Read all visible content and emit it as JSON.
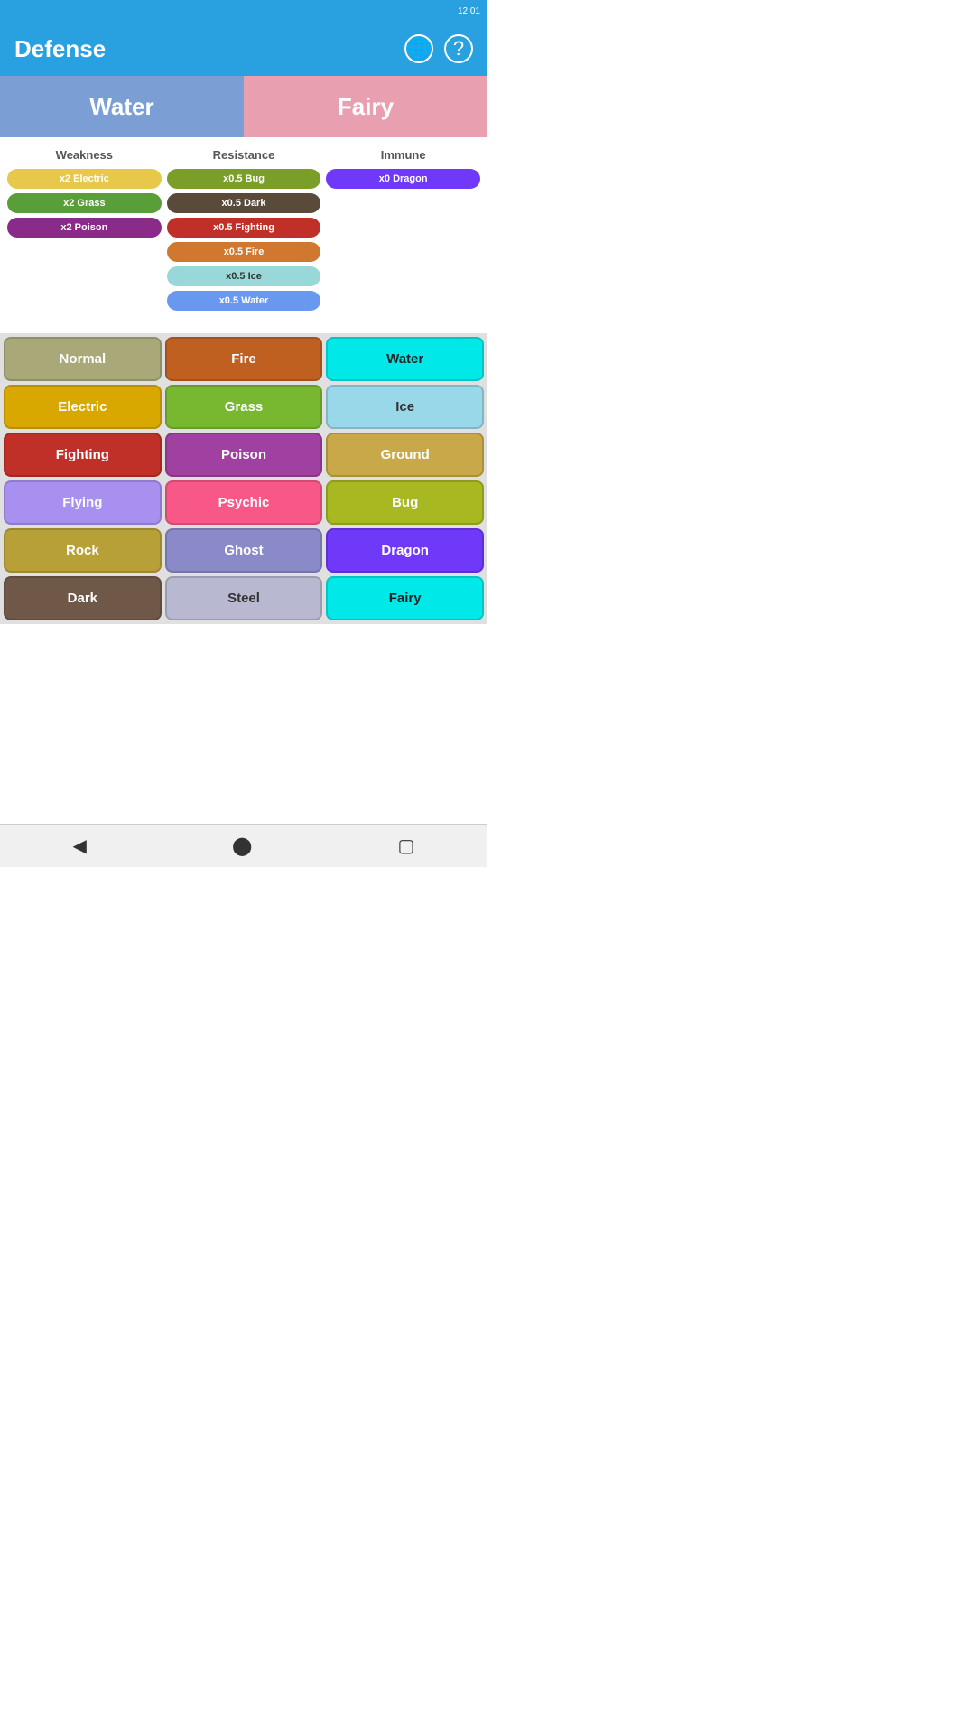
{
  "app": {
    "title": "Defense",
    "time": "12:01"
  },
  "header": {
    "title": "Defense",
    "globe_icon": "🌐",
    "help_icon": "?"
  },
  "type_selector": {
    "left": "Water",
    "right": "Fairy"
  },
  "defense": {
    "weakness_header": "Weakness",
    "resistance_header": "Resistance",
    "immune_header": "Immune",
    "weaknesses": [
      "x2 Electric",
      "x2 Grass",
      "x2 Poison"
    ],
    "resistances": [
      "x0.5 Bug",
      "x0.5 Dark",
      "x0.5 Fighting",
      "x0.5 Fire",
      "x0.5 Ice",
      "x0.5 Water"
    ],
    "immunities": [
      "x0 Dragon"
    ]
  },
  "type_grid": [
    {
      "label": "Normal",
      "style": "tg-normal"
    },
    {
      "label": "Fire",
      "style": "tg-fire"
    },
    {
      "label": "Water",
      "style": "tg-water"
    },
    {
      "label": "Electric",
      "style": "tg-electric"
    },
    {
      "label": "Grass",
      "style": "tg-grass"
    },
    {
      "label": "Ice",
      "style": "tg-ice"
    },
    {
      "label": "Fighting",
      "style": "tg-fighting"
    },
    {
      "label": "Poison",
      "style": "tg-poison"
    },
    {
      "label": "Ground",
      "style": "tg-ground"
    },
    {
      "label": "Flying",
      "style": "tg-flying"
    },
    {
      "label": "Psychic",
      "style": "tg-psychic"
    },
    {
      "label": "Bug",
      "style": "tg-bug"
    },
    {
      "label": "Rock",
      "style": "tg-rock"
    },
    {
      "label": "Ghost",
      "style": "tg-ghost"
    },
    {
      "label": "Dragon",
      "style": "tg-dragon"
    },
    {
      "label": "Dark",
      "style": "tg-dark"
    },
    {
      "label": "Steel",
      "style": "tg-steel"
    },
    {
      "label": "Fairy",
      "style": "tg-fairy"
    }
  ],
  "weakness_colors": [
    "badge-electric",
    "badge-grass",
    "badge-poison"
  ],
  "resistance_colors": [
    "badge-bug",
    "badge-dark",
    "badge-fighting",
    "badge-fire",
    "badge-ice",
    "badge-water"
  ],
  "immune_colors": [
    "badge-dragon"
  ],
  "nav": {
    "back": "◀",
    "home": "⬤",
    "square": "▢"
  }
}
